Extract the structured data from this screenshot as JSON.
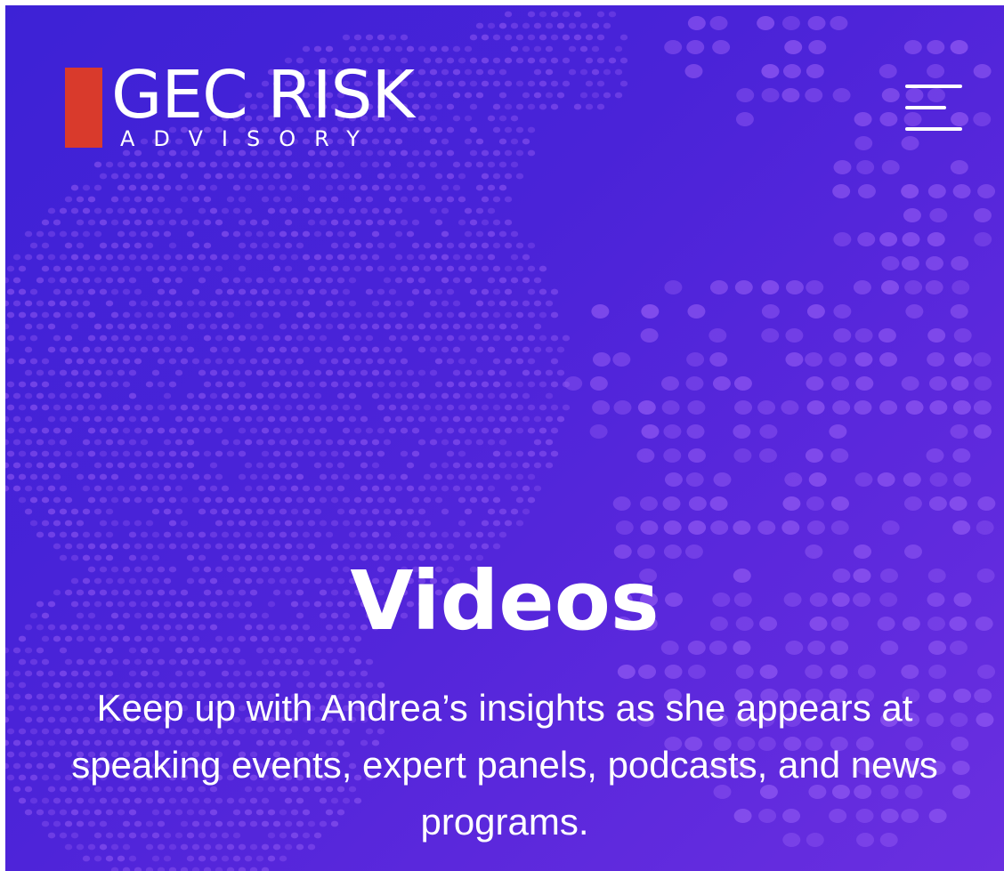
{
  "header": {
    "logo": {
      "main": "GEC RISK",
      "sub": "ADVISORY",
      "accent_color": "#d93a2c"
    },
    "menu_icon": "hamburger-menu-icon"
  },
  "hero": {
    "title": "Videos",
    "description": "Keep up with Andrea’s insights as she appears at speaking events, expert panels, podcasts, and news programs.",
    "background_color": "#4a23d8",
    "dot_color": "#8c55f0",
    "background_image": "dotted-world-map"
  }
}
